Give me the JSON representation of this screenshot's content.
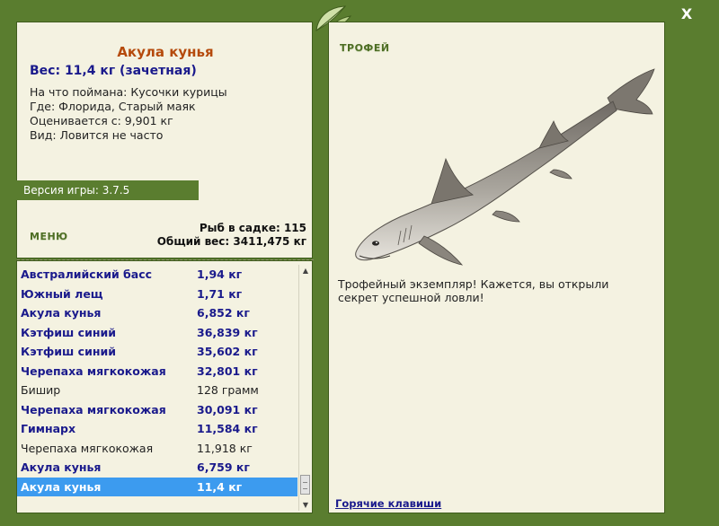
{
  "window": {
    "close_label": "X"
  },
  "details": {
    "fish_name": "Акула кунья",
    "weight_line": "Вес: 11,4 кг (зачетная)",
    "bait": "На что поймана: Кусочки курицы",
    "where": "Где: Флорида, Старый маяк",
    "rated_from": "Оценивается с: 9,901 кг",
    "kind": "Вид: Ловится не часто"
  },
  "version": "Версия игры: 3.7.5",
  "menu_label": "МЕНЮ",
  "stats": {
    "fish_count": "Рыб в садке: 115",
    "total_weight": "Общий вес: 3411,475 кг"
  },
  "catch_list": [
    {
      "name": "Австралийский басс",
      "weight": "1,94 кг",
      "trophy": true
    },
    {
      "name": "Южный лещ",
      "weight": "1,71 кг",
      "trophy": true
    },
    {
      "name": "Акула кунья",
      "weight": "6,852 кг",
      "trophy": true
    },
    {
      "name": "Кэтфиш синий",
      "weight": "36,839 кг",
      "trophy": true
    },
    {
      "name": "Кэтфиш синий",
      "weight": "35,602 кг",
      "trophy": true
    },
    {
      "name": "Черепаха мягкокожая",
      "weight": "32,801 кг",
      "trophy": true
    },
    {
      "name": "Бишир",
      "weight": "128 грамм",
      "trophy": false
    },
    {
      "name": "Черепаха мягкокожая",
      "weight": "30,091 кг",
      "trophy": true
    },
    {
      "name": "Гимнарх",
      "weight": "11,584 кг",
      "trophy": true
    },
    {
      "name": "Черепаха мягкокожая",
      "weight": "11,918 кг",
      "trophy": false
    },
    {
      "name": "Акула кунья",
      "weight": "6,759 кг",
      "trophy": true
    },
    {
      "name": "Акула кунья",
      "weight": "11,4 кг",
      "trophy": true,
      "selected": true
    }
  ],
  "trophy": {
    "label": "ТРОФЕЙ",
    "text": "Трофейный экземпляр! Кажется, вы открыли секрет успешной ловли!"
  },
  "hotkeys_label": "Горячие клавиши",
  "colors": {
    "frame": "#5a7d2f",
    "panel": "#f4f2e1",
    "trophy_text": "#1a1a8c",
    "title": "#b54a0c",
    "selection": "#3c9bef"
  }
}
